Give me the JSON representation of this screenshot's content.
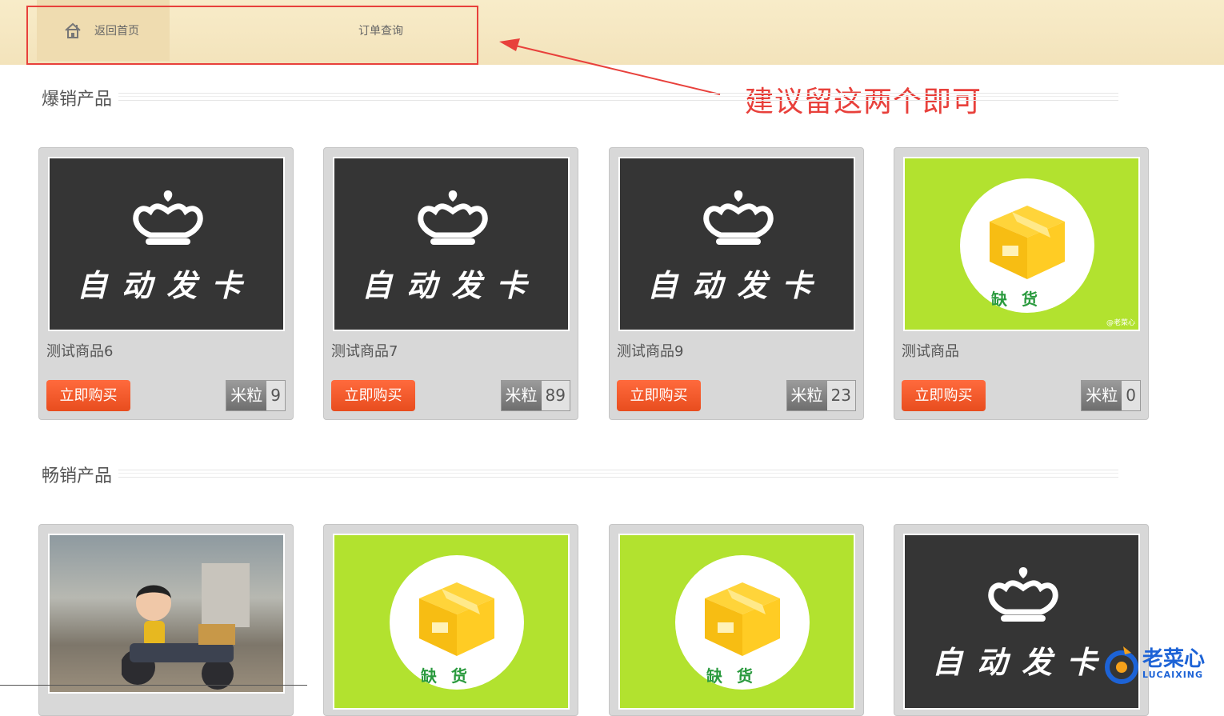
{
  "nav": {
    "home_label": "返回首页",
    "orders_label": "订单查询"
  },
  "annotation": "建议留这两个即可",
  "sections": [
    {
      "title": "爆销产品",
      "products": [
        {
          "name": "测试商品6",
          "buy_label": "立即购买",
          "unit": "米粒",
          "price": "9",
          "image": "auto-card"
        },
        {
          "name": "测试商品7",
          "buy_label": "立即购买",
          "unit": "米粒",
          "price": "89",
          "image": "auto-card"
        },
        {
          "name": "测试商品9",
          "buy_label": "立即购买",
          "unit": "米粒",
          "price": "23",
          "image": "auto-card"
        },
        {
          "name": "测试商品",
          "buy_label": "立即购买",
          "unit": "米粒",
          "price": "0",
          "image": "out-of-stock"
        }
      ]
    },
    {
      "title": "畅销产品",
      "products": [
        {
          "image": "photo"
        },
        {
          "image": "out-of-stock"
        },
        {
          "image": "out-of-stock"
        },
        {
          "image": "auto-card"
        }
      ]
    }
  ],
  "image_text": {
    "auto_card": "自动发卡",
    "out_of_stock": "缺货",
    "watermark": "@老菜心"
  },
  "logo": {
    "name": "老菜心",
    "sub": "LUCAIXING"
  },
  "colors": {
    "accent_red": "#e8403b",
    "buy_orange": "#f05a28",
    "card_gray": "#d8d8d8",
    "green": "#b2e22f"
  }
}
